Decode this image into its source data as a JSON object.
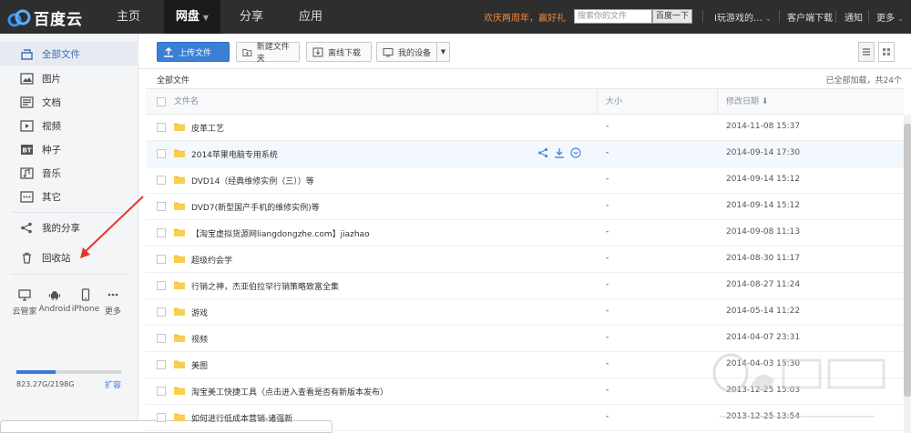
{
  "header": {
    "logo_text": "百度云",
    "nav": [
      {
        "label": "主页"
      },
      {
        "label": "网盘",
        "active": true
      },
      {
        "label": "分享"
      },
      {
        "label": "应用"
      }
    ],
    "promo": "欢庆两周年，赢好礼",
    "search_placeholder": "搜索你的文件",
    "search_button": "百度一下",
    "user": "I玩游戏的…",
    "client_download": "客户端下载",
    "notify": "通知",
    "more": "更多",
    "brand_color": "#2e2e2e"
  },
  "sidebar": {
    "items": [
      {
        "label": "全部文件",
        "icon": "all-files-icon",
        "active": true
      },
      {
        "label": "图片",
        "icon": "image-icon"
      },
      {
        "label": "文档",
        "icon": "document-icon"
      },
      {
        "label": "视频",
        "icon": "video-icon"
      },
      {
        "label": "种子",
        "icon": "bt-icon"
      },
      {
        "label": "音乐",
        "icon": "music-icon"
      },
      {
        "label": "其它",
        "icon": "other-icon"
      },
      {
        "label": "我的分享",
        "icon": "share-icon"
      },
      {
        "label": "回收站",
        "icon": "trash-icon"
      }
    ],
    "devices": [
      {
        "label": "云管家",
        "icon": "monitor-icon"
      },
      {
        "label": "Android",
        "icon": "android-icon"
      },
      {
        "label": "iPhone",
        "icon": "phone-icon"
      },
      {
        "label": "更多",
        "icon": "more-icon"
      }
    ],
    "quota": {
      "text": "823.27G/2198G",
      "used_fraction": 0.374,
      "expand_label": "扩容"
    }
  },
  "toolbar": {
    "upload": "上传文件",
    "new_folder": "新建文件夹",
    "offline_download": "离线下载",
    "my_devices": "我的设备"
  },
  "breadcrumb": "全部文件",
  "load_status": "已全部加载，共24个",
  "columns": {
    "name": "文件名",
    "size": "大小",
    "date": "修改日期 ⬇"
  },
  "files": [
    {
      "name": "皮革工艺",
      "size": "-",
      "date": "2014-11-08 15:37"
    },
    {
      "name": "2014苹果电脑专用系统",
      "size": "-",
      "date": "2014-09-14 17:30",
      "hover": true
    },
    {
      "name": "DVD14（经典维修实例（三））等",
      "size": "-",
      "date": "2014-09-14 15:12"
    },
    {
      "name": "DVD7(新型国产手机的维修实例)等",
      "size": "-",
      "date": "2014-09-14 15:12"
    },
    {
      "name": "【淘宝虚拟货源网liangdongzhe.com】jiazhao",
      "size": "-",
      "date": "2014-09-08 11:13"
    },
    {
      "name": "超级约会学",
      "size": "-",
      "date": "2014-08-30 11:17"
    },
    {
      "name": "行销之神，杰亚伯拉罕行销策略致富全集",
      "size": "-",
      "date": "2014-08-27 11:24"
    },
    {
      "name": "游戏",
      "size": "-",
      "date": "2014-05-14 11:22"
    },
    {
      "name": "视频",
      "size": "-",
      "date": "2014-04-07 23:31"
    },
    {
      "name": "美图",
      "size": "-",
      "date": "2014-04-03 15:30"
    },
    {
      "name": "淘宝美工快捷工具（点击进入查看是否有新版本发布）",
      "size": "-",
      "date": "2013-12-25 15:03"
    },
    {
      "name": "如何进行低成本营销-诸强新",
      "size": "-",
      "date": "2013-12-25 13:54"
    }
  ],
  "colors": {
    "accent": "#3b7fd6",
    "sidebar_bg": "#f4f5f7",
    "annotation": "#e8332a"
  }
}
